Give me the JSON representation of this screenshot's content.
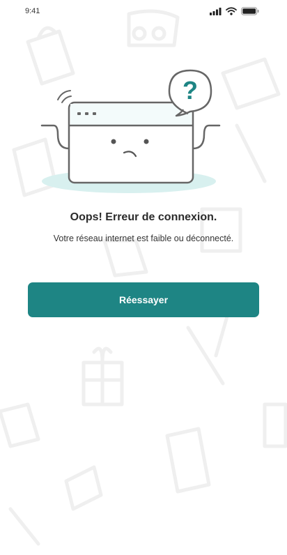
{
  "status_bar": {
    "time": "9:41"
  },
  "error": {
    "title": "Oops! Erreur de connexion.",
    "message": "Votre réseau internet est faible ou déconnecté."
  },
  "actions": {
    "retry_label": "Réessayer"
  },
  "illustration": {
    "bubble_symbol": "?"
  },
  "colors": {
    "accent": "#1e8584",
    "illustration_shadow": "#d8f0ef",
    "doodle": "#ececec"
  }
}
